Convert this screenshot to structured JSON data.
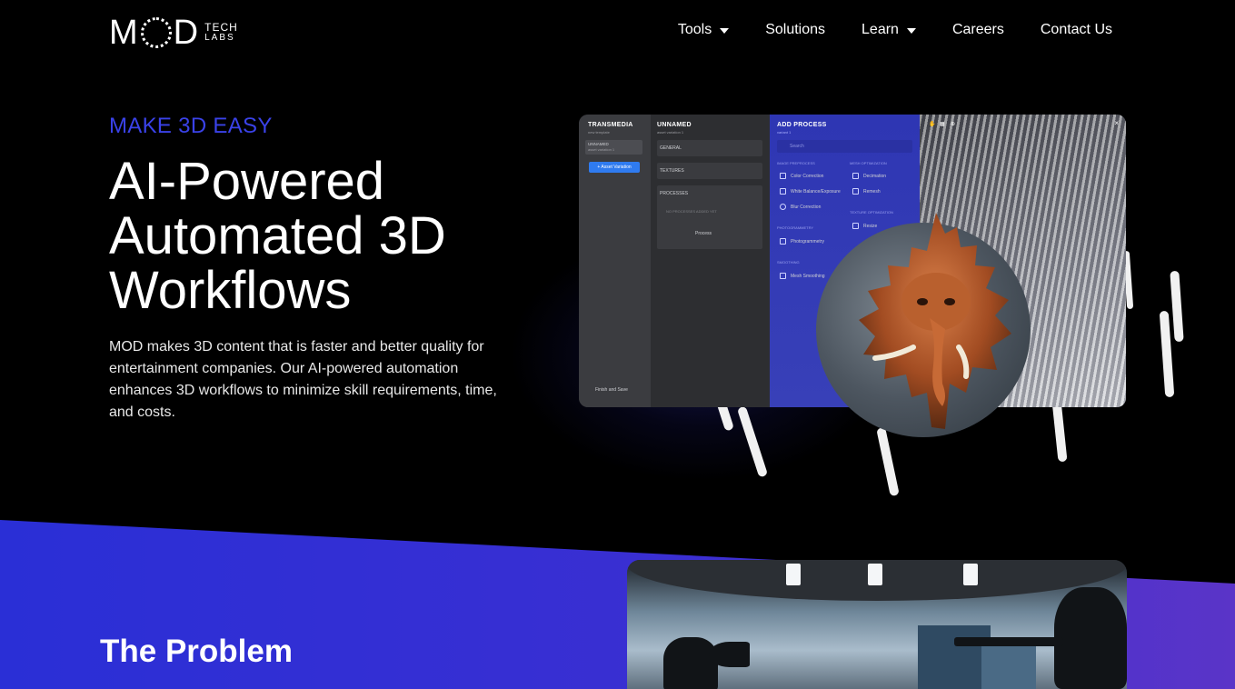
{
  "nav": {
    "logo": {
      "mod": "M",
      "mod_end": "D",
      "tech": "TECH",
      "labs": "LABS"
    },
    "items": [
      {
        "label": "Tools",
        "dropdown": true
      },
      {
        "label": "Solutions",
        "dropdown": false
      },
      {
        "label": "Learn",
        "dropdown": true
      },
      {
        "label": "Careers",
        "dropdown": false
      },
      {
        "label": "Contact Us",
        "dropdown": false
      }
    ]
  },
  "hero": {
    "eyebrow": "MAKE 3D EASY",
    "headline_line1": "AI-Powered",
    "headline_line2": "Automated 3D",
    "headline_line3": "Workflows",
    "description": "MOD makes 3D content that is faster and better quality for entertainment companies. Our AI-powered automation enhances 3D workflows to minimize skill requirements, time, and costs."
  },
  "app_mockup": {
    "panel1": {
      "title": "TRANSMEDIA",
      "subtitle": "new template",
      "item_title": "UNNAMED",
      "item_sub": "asset variation 1",
      "add_button": "+  Asset Variation",
      "finish": "Finish and Save"
    },
    "panel2": {
      "title": "UNNAMED",
      "subtitle": "asset variation 1",
      "sections": [
        "GENERAL",
        "TEXTURES",
        "PROCESSES"
      ],
      "empty": "NO PROCESSES ADDED YET",
      "process_btn": "Process"
    },
    "panel3": {
      "title": "ADD PROCESS",
      "subtitle": "variant 1",
      "search_placeholder": "Search",
      "col1_head": "IMAGE PREPROCESS",
      "col1": [
        "Color Correction",
        "White Balance/Exposure",
        "Blur Correction"
      ],
      "photogrammetry_head": "PHOTOGRAMMETRY",
      "photogrammetry": "Photogrammetry",
      "smoothing_head": "SMOOTHING",
      "smoothing": "Mesh Smoothing",
      "col2_head": "MESH OPTIMIZATION",
      "col2": [
        "Decimation",
        "Remesh"
      ],
      "texture_head": "TEXTURE OPTIMIZATION",
      "texture": "Resize"
    },
    "close": "×"
  },
  "problem": {
    "title": "The Problem"
  },
  "colors": {
    "accent": "#3a42e8",
    "band_start": "#2a2fd6",
    "band_end": "#5a34c8",
    "background": "#000000"
  }
}
